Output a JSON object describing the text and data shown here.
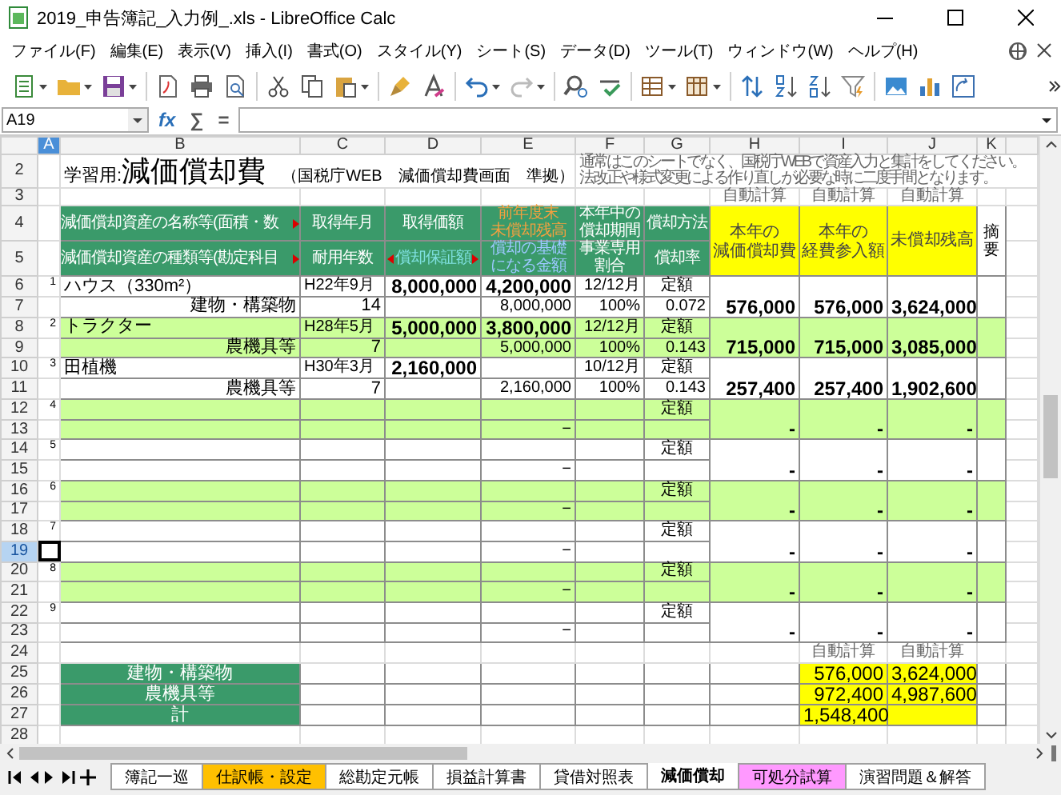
{
  "window": {
    "title": "2019_申告簿記_入力例_.xls - LibreOffice Calc"
  },
  "menu": [
    "ファイル(F)",
    "編集(E)",
    "表示(V)",
    "挿入(I)",
    "書式(O)",
    "スタイル(Y)",
    "シート(S)",
    "データ(D)",
    "ツール(T)",
    "ウィンドウ(W)",
    "ヘルプ(H)"
  ],
  "formula_bar": {
    "cell_reference": "A19",
    "buttons": [
      "fx",
      "∑",
      "="
    ]
  },
  "columns": [
    {
      "label": "A",
      "selected": true
    },
    {
      "label": "B",
      "selected": false
    },
    {
      "label": "C",
      "selected": false
    },
    {
      "label": "D",
      "selected": false
    },
    {
      "label": "E",
      "selected": false
    },
    {
      "label": "F",
      "selected": false
    },
    {
      "label": "G",
      "selected": false
    },
    {
      "label": "H",
      "selected": false
    },
    {
      "label": "I",
      "selected": false
    },
    {
      "label": "J",
      "selected": false
    },
    {
      "label": "K",
      "selected": false
    }
  ],
  "rows": [
    {
      "number": "2",
      "selected": false
    },
    {
      "number": "3",
      "selected": false
    },
    {
      "number": "4",
      "selected": false
    },
    {
      "number": "5",
      "selected": false
    },
    {
      "number": "6",
      "selected": false
    },
    {
      "number": "7",
      "selected": false
    },
    {
      "number": "8",
      "selected": false
    },
    {
      "number": "9",
      "selected": false
    },
    {
      "number": "10",
      "selected": false
    },
    {
      "number": "11",
      "selected": false
    },
    {
      "number": "12",
      "selected": false
    },
    {
      "number": "13",
      "selected": false
    },
    {
      "number": "14",
      "selected": false
    },
    {
      "number": "15",
      "selected": false
    },
    {
      "number": "16",
      "selected": false
    },
    {
      "number": "17",
      "selected": false
    },
    {
      "number": "18",
      "selected": false
    },
    {
      "number": "19",
      "selected": true
    },
    {
      "number": "20",
      "selected": false
    },
    {
      "number": "21",
      "selected": false
    },
    {
      "number": "22",
      "selected": false
    },
    {
      "number": "23",
      "selected": false
    },
    {
      "number": "24",
      "selected": false
    },
    {
      "number": "25",
      "selected": false
    },
    {
      "number": "26",
      "selected": false
    },
    {
      "number": "27",
      "selected": false
    },
    {
      "number": "28",
      "selected": false
    }
  ],
  "title_block": {
    "prefix": "学習用:",
    "title": "減価償却費",
    "subtitle": "（国税庁WEB　減価償却費画面　準拠）",
    "notes": [
      "通常はこのシートでなく、国税庁WEBで資産入力と集計をしてください。",
      "法改正や様式変更による作り直しが必要な時に二度手間となります。"
    ]
  },
  "auto_calc_labels": [
    "自動計算",
    "自動計算",
    "自動計算"
  ],
  "header": {
    "name": "減価償却資産の名称等(面積・数",
    "acquired": "取得年月",
    "cost": "取得価額",
    "prior_balance": [
      "前年度末",
      "未償却残高"
    ],
    "period": [
      "本年中の",
      "償却期間"
    ],
    "method": "償却方法",
    "depreciation": [
      "本年の",
      "減価償却費"
    ],
    "expense": [
      "本年の",
      "経費参入額"
    ],
    "remaining": "未償却残高",
    "remarks": "摘要",
    "category": "減価償却資産の種類等(勘定科目",
    "life": "耐用年数",
    "guarantee": "償却保証額",
    "basis": [
      "償却の基礎",
      "になる金額"
    ],
    "ratio": [
      "事業専用",
      "割合"
    ],
    "rate": "償却率"
  },
  "assets": [
    {
      "no": "1",
      "name": "ハウス（330m²）",
      "acquired": "H22年9月",
      "cost": "8,000,000",
      "prior_balance": "4,200,000",
      "period": "12/12月",
      "method": "定額",
      "category": "建物・構築物",
      "life": "14",
      "basis": "8,000,000",
      "ratio": "100%",
      "rate": "0.072",
      "depreciation": "576,000",
      "expense": "576,000",
      "remaining": "3,624,000",
      "highlighted": false
    },
    {
      "no": "2",
      "name": "トラクター",
      "acquired": "H28年5月",
      "cost": "5,000,000",
      "prior_balance": "3,800,000",
      "period": "12/12月",
      "method": "定額",
      "category": "農機具等",
      "life": "7",
      "basis": "5,000,000",
      "ratio": "100%",
      "rate": "0.143",
      "depreciation": "715,000",
      "expense": "715,000",
      "remaining": "3,085,000",
      "highlighted": true
    },
    {
      "no": "3",
      "name": "田植機",
      "acquired": "H30年3月",
      "cost": "2,160,000",
      "period": "10/12月",
      "method": "定額",
      "category": "農機具等",
      "life": "7",
      "basis": "2,160,000",
      "ratio": "100%",
      "rate": "0.143",
      "depreciation": "257,400",
      "expense": "257,400",
      "remaining": "1,902,600",
      "highlighted": false
    },
    {
      "no": "4",
      "method": "定額",
      "basis": "−",
      "depreciation": "-",
      "expense": "-",
      "remaining": "-",
      "highlighted": true
    },
    {
      "no": "5",
      "method": "定額",
      "basis": "−",
      "depreciation": "-",
      "expense": "-",
      "remaining": "-",
      "highlighted": false
    },
    {
      "no": "6",
      "method": "定額",
      "basis": "−",
      "depreciation": "-",
      "expense": "-",
      "remaining": "-",
      "highlighted": true
    },
    {
      "no": "7",
      "method": "定額",
      "basis": "−",
      "depreciation": "-",
      "expense": "-",
      "remaining": "-",
      "highlighted": false
    },
    {
      "no": "8",
      "method": "定額",
      "basis": "−",
      "depreciation": "-",
      "expense": "-",
      "remaining": "-",
      "highlighted": true
    },
    {
      "no": "9",
      "method": "定額",
      "basis": "−",
      "depreciation": "-",
      "expense": "-",
      "remaining": "-",
      "highlighted": false
    }
  ],
  "summary": {
    "auto_calc_labels": [
      "自動計算",
      "自動計算"
    ],
    "rows": [
      {
        "label": "建物・構築物",
        "expense": "576,000",
        "remaining": "3,624,000"
      },
      {
        "label": "農機具等",
        "expense": "972,400",
        "remaining": "4,987,600"
      },
      {
        "label": "計",
        "expense": "1,548,400"
      }
    ]
  },
  "sheet_tabs": [
    {
      "label": "簿記一巡",
      "selected": false,
      "color": "#ffffff"
    },
    {
      "label": "仕訳帳・設定",
      "selected": false,
      "color": "#ffc000"
    },
    {
      "label": "総勘定元帳",
      "selected": false,
      "color": "#ffffff"
    },
    {
      "label": "損益計算書",
      "selected": false,
      "color": "#ffffff"
    },
    {
      "label": "貸借対照表",
      "selected": false,
      "color": "#ffffff"
    },
    {
      "label": "減価償却",
      "selected": true,
      "color": "#ffffff"
    },
    {
      "label": "可処分試算",
      "selected": false,
      "color": "#ff99ff"
    },
    {
      "label": "演習問題＆解答",
      "selected": false,
      "color": "#ffffff"
    }
  ]
}
